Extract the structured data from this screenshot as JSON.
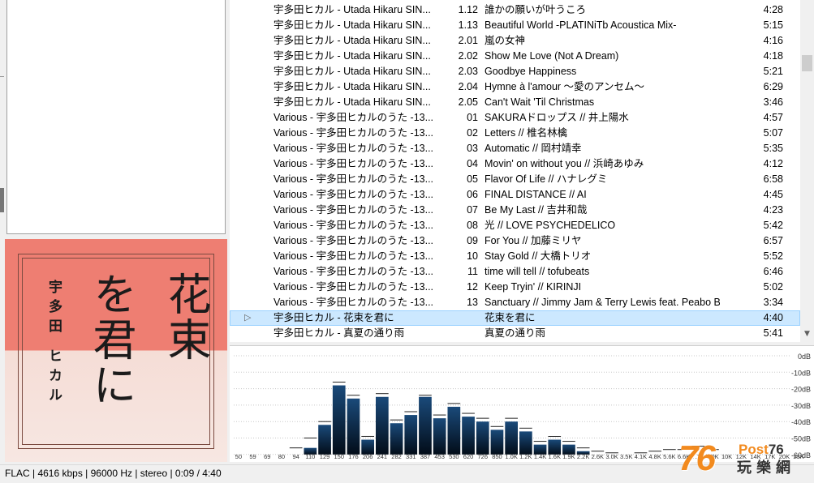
{
  "playlist": {
    "rows": [
      {
        "icon": "",
        "artist": "宇多田ヒカル - Utada Hikaru SIN...",
        "num": "1.12",
        "title": "誰かの願いが叶うころ",
        "time": "4:28"
      },
      {
        "icon": "",
        "artist": "宇多田ヒカル - Utada Hikaru SIN...",
        "num": "1.13",
        "title": "Beautiful World -PLATINiTb Acoustica Mix-",
        "time": "5:15"
      },
      {
        "icon": "",
        "artist": "宇多田ヒカル - Utada Hikaru SIN...",
        "num": "2.01",
        "title": "嵐の女神",
        "time": "4:16"
      },
      {
        "icon": "",
        "artist": "宇多田ヒカル - Utada Hikaru SIN...",
        "num": "2.02",
        "title": "Show Me Love (Not A Dream)",
        "time": "4:18"
      },
      {
        "icon": "",
        "artist": "宇多田ヒカル - Utada Hikaru SIN...",
        "num": "2.03",
        "title": "Goodbye Happiness",
        "time": "5:21"
      },
      {
        "icon": "",
        "artist": "宇多田ヒカル - Utada Hikaru SIN...",
        "num": "2.04",
        "title": "Hymne à l'amour ～愛のアンセム～",
        "time": "6:29"
      },
      {
        "icon": "",
        "artist": "宇多田ヒカル - Utada Hikaru SIN...",
        "num": "2.05",
        "title": "Can't Wait 'Til Christmas",
        "time": "3:46"
      },
      {
        "icon": "",
        "artist": "Various - 宇多田ヒカルのうた -13...",
        "num": "01",
        "title": "SAKURAドロップス // 井上陽水",
        "time": "4:57"
      },
      {
        "icon": "",
        "artist": "Various - 宇多田ヒカルのうた -13...",
        "num": "02",
        "title": "Letters // 椎名林檎",
        "time": "5:07"
      },
      {
        "icon": "",
        "artist": "Various - 宇多田ヒカルのうた -13...",
        "num": "03",
        "title": "Automatic // 岡村靖幸",
        "time": "5:35"
      },
      {
        "icon": "",
        "artist": "Various - 宇多田ヒカルのうた -13...",
        "num": "04",
        "title": "Movin' on without you // 浜崎あゆみ",
        "time": "4:12"
      },
      {
        "icon": "",
        "artist": "Various - 宇多田ヒカルのうた -13...",
        "num": "05",
        "title": "Flavor Of Life // ハナレグミ",
        "time": "6:58"
      },
      {
        "icon": "",
        "artist": "Various - 宇多田ヒカルのうた -13...",
        "num": "06",
        "title": "FINAL DISTANCE // AI",
        "time": "4:45"
      },
      {
        "icon": "",
        "artist": "Various - 宇多田ヒカルのうた -13...",
        "num": "07",
        "title": "Be My Last // 吉井和哉",
        "time": "4:23"
      },
      {
        "icon": "",
        "artist": "Various - 宇多田ヒカルのうた -13...",
        "num": "08",
        "title": "光 // LOVE PSYCHEDELICO",
        "time": "5:42"
      },
      {
        "icon": "",
        "artist": "Various - 宇多田ヒカルのうた -13...",
        "num": "09",
        "title": "For You // 加藤ミリヤ",
        "time": "6:57"
      },
      {
        "icon": "",
        "artist": "Various - 宇多田ヒカルのうた -13...",
        "num": "10",
        "title": "Stay Gold // 大橋トリオ",
        "time": "5:52"
      },
      {
        "icon": "",
        "artist": "Various - 宇多田ヒカルのうた -13...",
        "num": "11",
        "title": "time will tell // tofubeats",
        "time": "6:46"
      },
      {
        "icon": "",
        "artist": "Various - 宇多田ヒカルのうた -13...",
        "num": "12",
        "title": "Keep Tryin' // KIRINJI",
        "time": "5:02"
      },
      {
        "icon": "",
        "artist": "Various - 宇多田ヒカルのうた -13...",
        "num": "13",
        "title": "Sanctuary // Jimmy Jam & Terry Lewis feat. Peabo Br...",
        "time": "3:34"
      },
      {
        "icon": "▷",
        "artist": "宇多田ヒカル - 花束を君に",
        "num": "",
        "title": "花束を君に",
        "time": "4:40",
        "active": true
      },
      {
        "icon": "",
        "artist": "宇多田ヒカル - 真夏の通り雨",
        "num": "",
        "title": "真夏の通り雨",
        "time": "5:41"
      }
    ]
  },
  "album_art": {
    "artist_vertical": "宇多田 ヒカル",
    "title_col1": "花束",
    "title_col2": "を君に"
  },
  "spectrum": {
    "db_labels": [
      "0dB",
      "-10dB",
      "-20dB",
      "-30dB",
      "-40dB",
      "-50dB",
      "-60dB"
    ],
    "freq_labels": [
      "50",
      "59",
      "69",
      "80",
      "94",
      "110",
      "129",
      "150",
      "176",
      "206",
      "241",
      "282",
      "331",
      "387",
      "453",
      "530",
      "620",
      "726",
      "850",
      "1.0K",
      "1.2K",
      "1.4K",
      "1.6K",
      "1.9K",
      "2.2K",
      "2.6K",
      "3.0K",
      "3.5K",
      "4.1K",
      "4.8K",
      "5.6K",
      "6.6K",
      "7.7K",
      "9.0K",
      "10K",
      "12K",
      "14K",
      "17K",
      "20K",
      "23K"
    ],
    "levels_db": [
      -60,
      -60,
      -60,
      -60,
      -60,
      -56,
      -42,
      -18,
      -26,
      -51,
      -25,
      -41,
      -36,
      -25,
      -38,
      -31,
      -37,
      -40,
      -45,
      -40,
      -46,
      -54,
      -51,
      -54,
      -58,
      -60,
      -60,
      -60,
      -60,
      -60,
      -60,
      -60,
      -60,
      -60,
      -60,
      -60,
      -60,
      -60,
      -60,
      -60
    ],
    "peaks_db": [
      -60,
      -60,
      -60,
      -60,
      -56,
      -50,
      -40,
      -16,
      -24,
      -49,
      -23,
      -39,
      -34,
      -24,
      -36,
      -29,
      -35,
      -38,
      -43,
      -38,
      -44,
      -52,
      -49,
      -52,
      -56,
      -58,
      -59,
      -60,
      -59,
      -58,
      -57,
      -57,
      -55,
      -57,
      -60,
      -60,
      -60,
      -60,
      -60,
      -60
    ],
    "colors": {
      "bar_top": "#1a4a7a",
      "bar_bottom": "#020c18",
      "peak": "#222222",
      "grid": "#c8c8c8"
    }
  },
  "status": {
    "text": "FLAC | 4616 kbps | 96000 Hz | stereo | 0:09 / 4:40"
  },
  "watermark": {
    "num": "76",
    "post": "Post76",
    "cjk": "玩樂網"
  }
}
